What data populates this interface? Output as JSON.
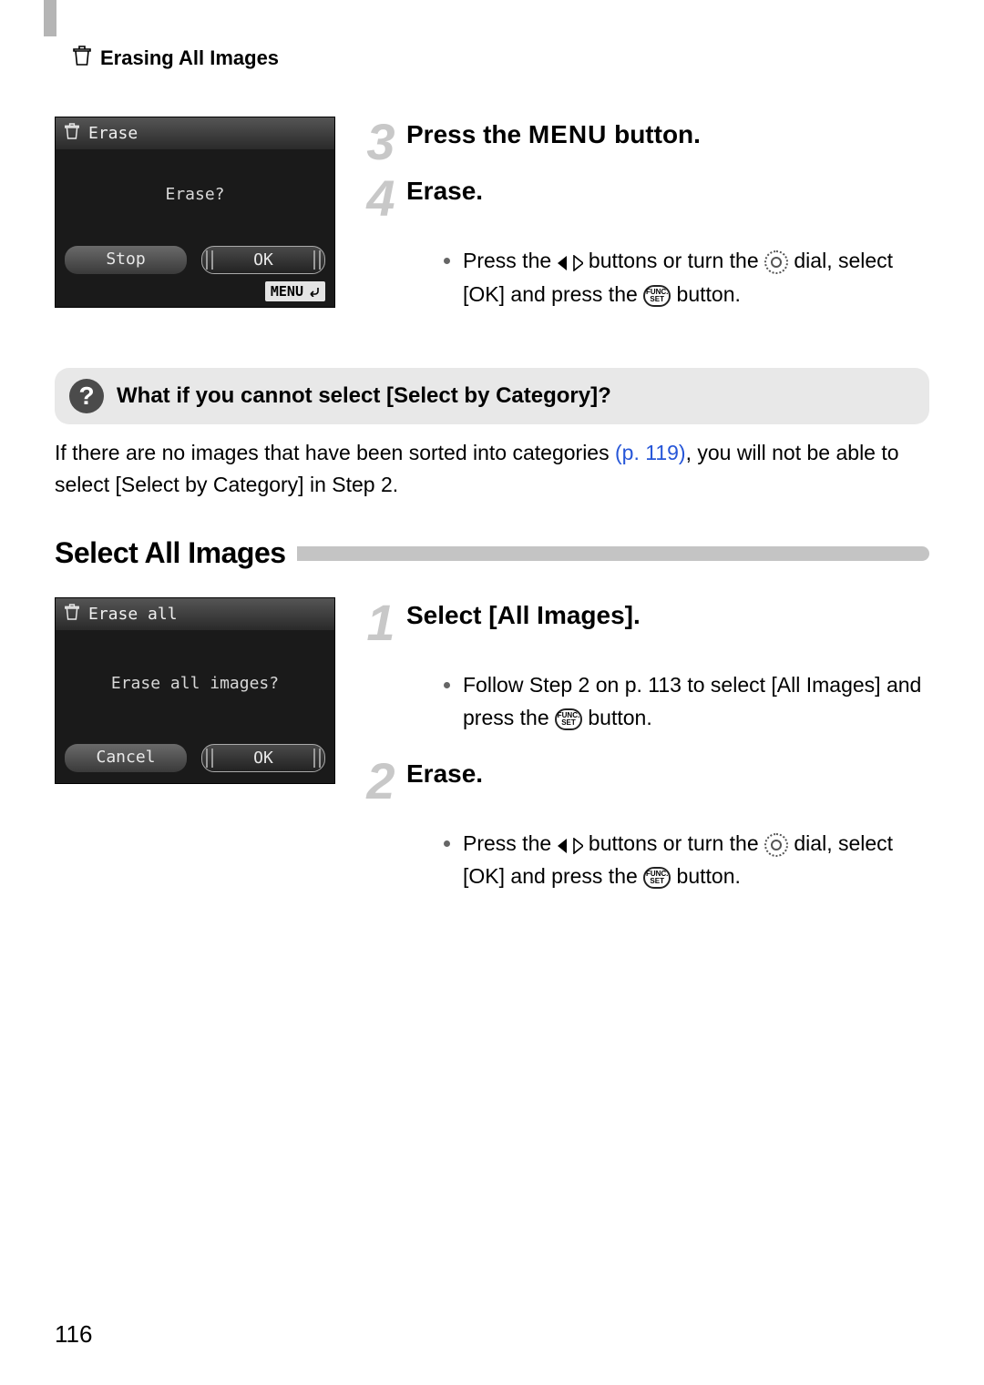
{
  "header": {
    "title": "Erasing All Images"
  },
  "lcd1": {
    "title": "Erase",
    "prompt": "Erase?",
    "btn_stop": "Stop",
    "btn_ok": "OK",
    "menu_label": "MENU"
  },
  "steps34": {
    "s3": {
      "num": "3",
      "title_a": "Press the ",
      "title_menu": "MENU",
      "title_b": " button."
    },
    "s4": {
      "num": "4",
      "title": "Erase.",
      "body_a": "Press the ",
      "body_b": " buttons or turn the ",
      "body_c": " dial, select [OK] and press the ",
      "body_d": " button."
    }
  },
  "note": {
    "title": "What if you cannot select [Select by Category]?",
    "text_a": "If there are no images that have been sorted into categories ",
    "link": "(p. 119)",
    "text_b": ", you will not be able to select [Select by Category] in Step 2."
  },
  "section2_title": "Select All Images",
  "lcd2": {
    "title": "Erase all",
    "prompt": "Erase all images?",
    "btn_cancel": "Cancel",
    "btn_ok": "OK"
  },
  "steps12": {
    "s1": {
      "num": "1",
      "title": "Select [All Images].",
      "body_a": "Follow Step 2 on ",
      "link": "p. 113",
      "body_b": " to select [All Images] and press the ",
      "body_c": " button."
    },
    "s2": {
      "num": "2",
      "title": "Erase.",
      "body_a": "Press the ",
      "body_b": " buttons or turn the ",
      "body_c": " dial, select [OK] and press the ",
      "body_d": " button."
    }
  },
  "funcset": {
    "line1": "FUNC.",
    "line2": "SET"
  },
  "page_number": "116"
}
